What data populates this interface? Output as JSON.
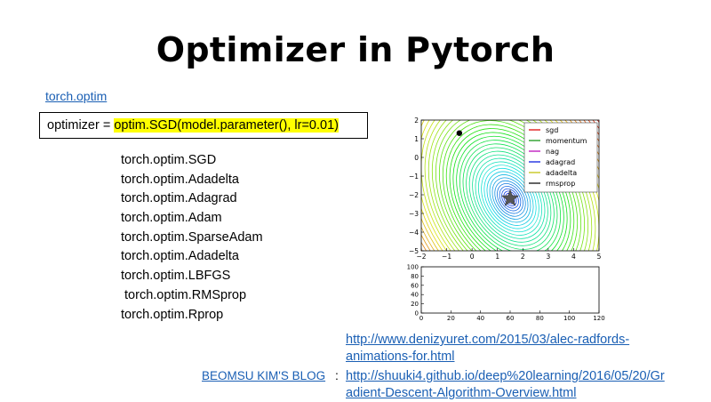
{
  "title": "Optimizer in Pytorch",
  "torch_link": "torch.optim",
  "code": {
    "prefix": "optimizer = ",
    "highlighted": "optim.SGD(model.parameter(), lr=0.01)",
    "highlight_color": "#ffff00"
  },
  "optimizers": [
    "torch.optim.SGD",
    "torch.optim.Adadelta",
    "torch.optim.Adagrad",
    "torch.optim.Adam",
    "torch.optim.SparseAdam",
    "torch.optim.Adadelta",
    "torch.optim.LBFGS",
    " torch.optim.RMSprop",
    "torch.optim.Rprop"
  ],
  "chart_data": [
    {
      "type": "line",
      "xlim": [
        -2,
        5
      ],
      "ylim": [
        -5,
        2
      ],
      "x_ticks": [
        "−2",
        "−1",
        "0",
        "1",
        "2",
        "3",
        "4",
        "5"
      ],
      "y_ticks": [
        "2",
        "1",
        "0",
        "−1",
        "−2",
        "−3",
        "−4",
        "−5"
      ],
      "start_point": [
        -0.5,
        1.3
      ],
      "minimum_star": [
        1.5,
        -2.2
      ],
      "legend_position": "top-right",
      "series": [
        {
          "name": "sgd",
          "color": "#e02020"
        },
        {
          "name": "momentum",
          "color": "#2aa02a"
        },
        {
          "name": "nag",
          "color": "#c020c0"
        },
        {
          "name": "adagrad",
          "color": "#2030e0"
        },
        {
          "name": "adadelta",
          "color": "#c8c820"
        },
        {
          "name": "rmsprop",
          "color": "#222222"
        }
      ]
    },
    {
      "type": "line",
      "xlim": [
        0,
        120
      ],
      "ylim": [
        0,
        100
      ],
      "x_ticks": [
        "0",
        "20",
        "40",
        "60",
        "80",
        "100",
        "120"
      ],
      "y_ticks": [
        "100",
        "80",
        "60",
        "40",
        "20",
        "0"
      ]
    }
  ],
  "links": {
    "denizyuret_line1": "http://www.denizyuret.com/2015/03/alec-radfords-",
    "denizyuret_line2": "animations-for.html",
    "blog_label": "BEOMSU KIM'S BLOG",
    "colon": ":",
    "shuuki_line1": "http://shuuki4.github.io/deep%20learning/2016/05/20/Gr",
    "shuuki_line2": "adient-Descent-Algorithm-Overview.html"
  }
}
